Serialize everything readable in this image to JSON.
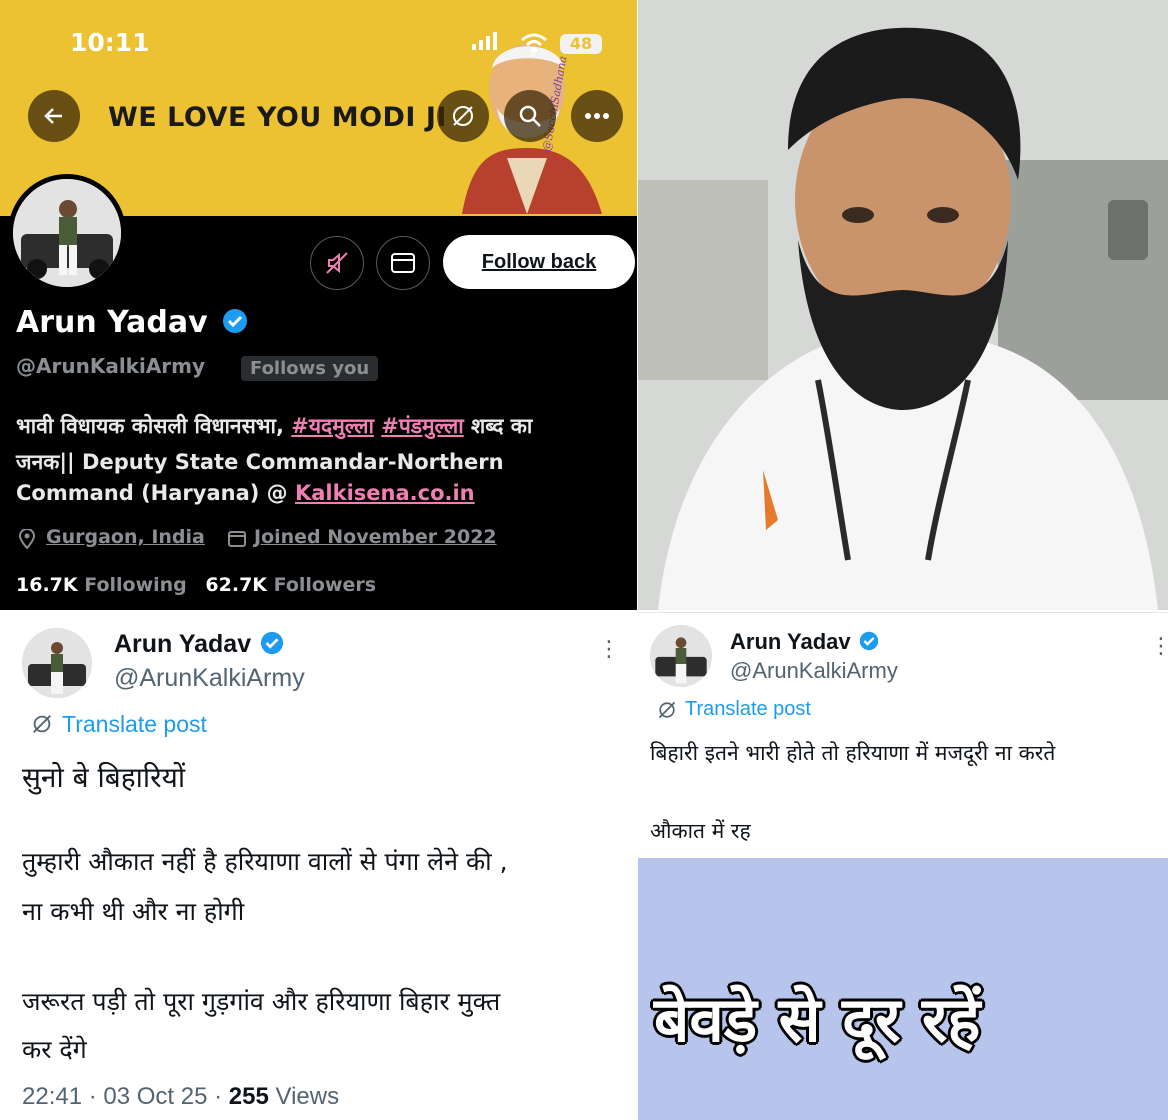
{
  "profile": {
    "status_time": "10:11",
    "battery": "48",
    "banner_text": "WE LOVE YOU MODI JI",
    "banner_signature": "@SacchiSadhana",
    "name": "Arun Yadav",
    "handle": "@ArunKalkiArmy",
    "follows_you": "Follows you",
    "follow_back": "Follow back",
    "bio": {
      "line1_a": "भावी विधायक कोसली विधानसभा, ",
      "line1_tag1": "#यदमुल्ला",
      "line1_tag2": "#पंडमुल्ला",
      "line1_b": " शब्द का",
      "line2": "जनक|| Deputy State Commandar-Northern",
      "line3_a": "Command (Haryana) @ ",
      "line3_link": "Kalkisena.co.in"
    },
    "location": "Gurgaon, India",
    "joined": "Joined November 2022",
    "following_count": "16.7K",
    "following_label": "Following",
    "followers_count": "62.7K",
    "followers_label": "Followers"
  },
  "tweet1": {
    "name": "Arun Yadav",
    "handle": "@ArunKalkiArmy",
    "translate": "Translate post",
    "line1": "सुनो बे बिहारियों",
    "line2": "तुम्हारी औकात नहीं है हरियाणा वालों से पंगा लेने की ,",
    "line3": "ना कभी थी और ना होगी",
    "line4": "जरूरत पड़ी तो पूरा गुड़गांव और हरियाणा बिहार मुक्त",
    "line5": "कर देंगे",
    "time": "22:41 · 03 Oct 25 · ",
    "views_count": "255",
    "views_label": " Views"
  },
  "tweet2": {
    "name": "Arun Yadav",
    "handle": "@ArunKalkiArmy",
    "translate": "Translate post",
    "line1": "बिहारी इतने भारी होते तो हरियाणा में मजदूरी ना करते",
    "line2": "औकात में रह"
  },
  "caption": "बेवड़े से दूर रहें",
  "colors": {
    "banner": "#ecc233",
    "verified": "#1d9bf0",
    "link_pink": "#f080b4",
    "caption_bg": "#b7c5ec"
  }
}
